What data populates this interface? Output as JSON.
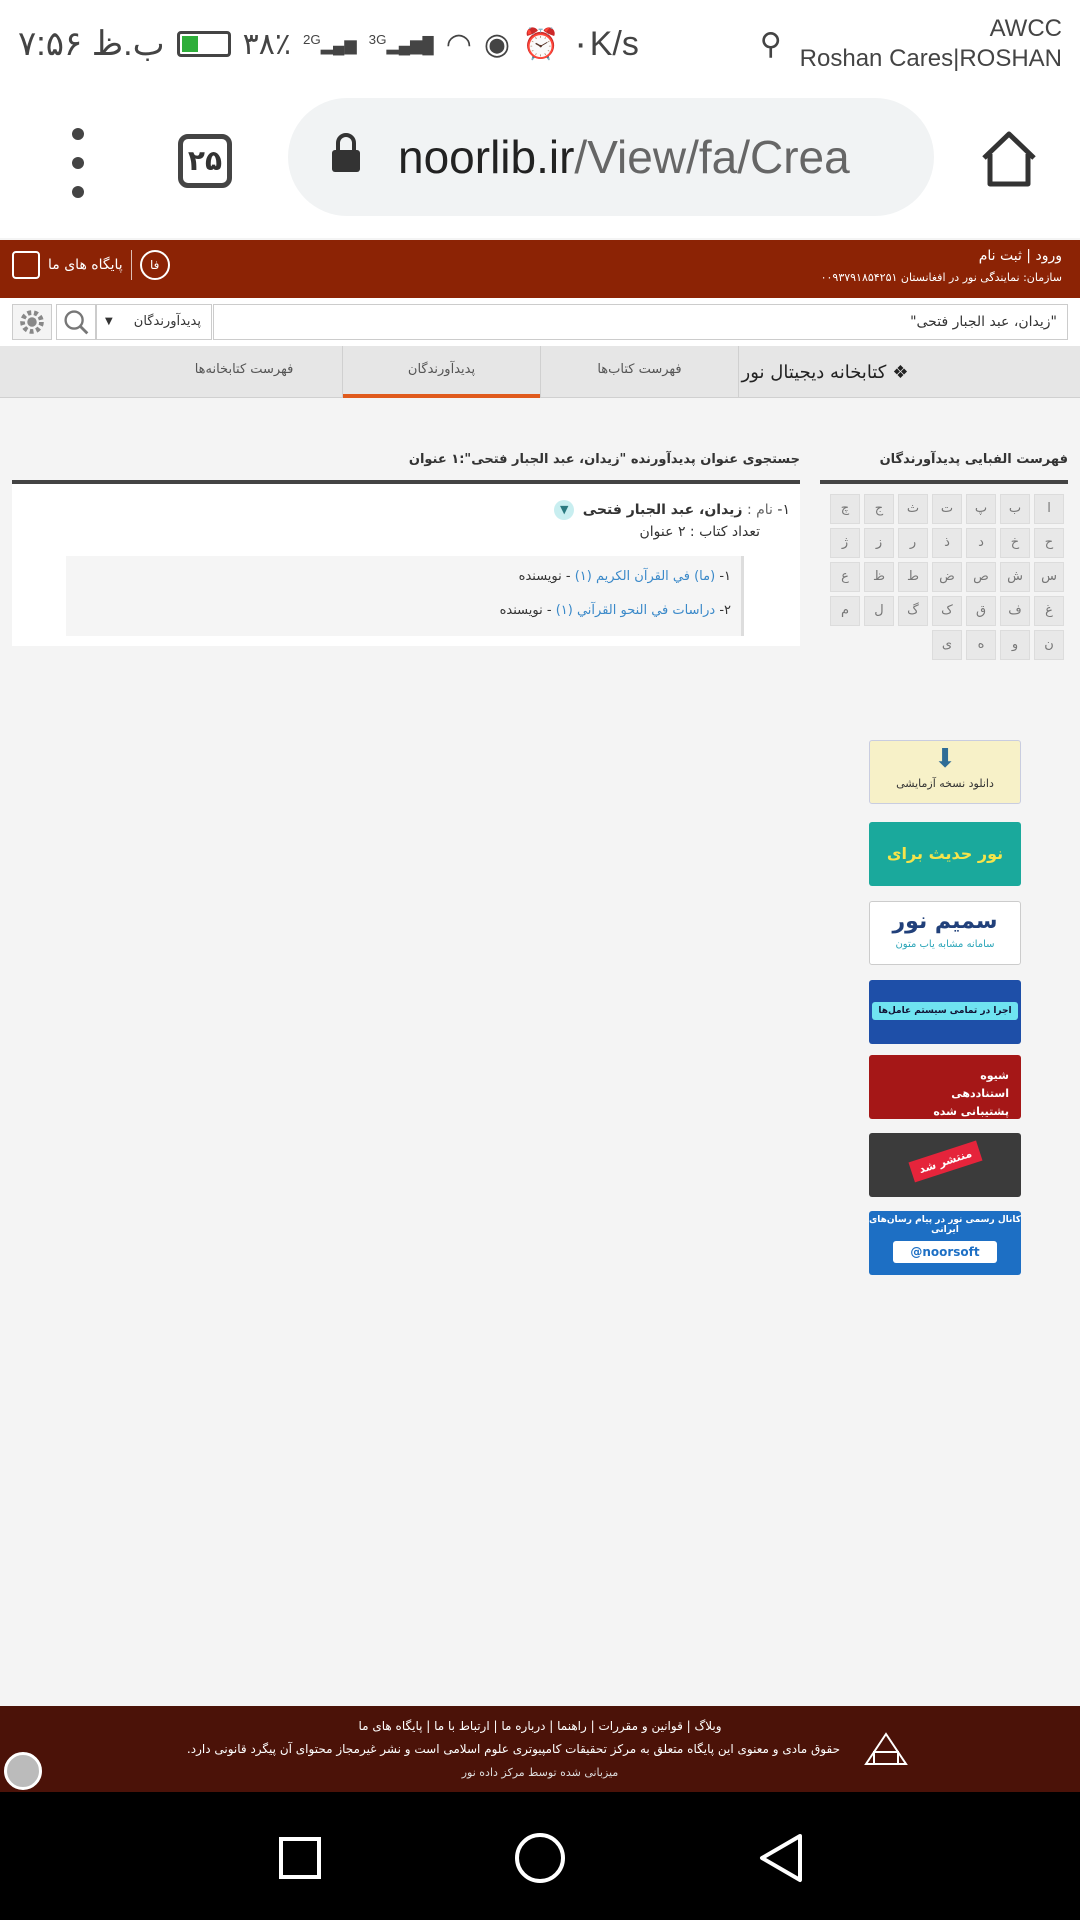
{
  "status_bar": {
    "time": "۷:۵۶ ب.ظ",
    "battery": "۳۸٪",
    "battery_fill": 0.38,
    "network": "2G",
    "network2": "3G",
    "speed": "۰K/s",
    "carrier_1": "AWCC",
    "carrier_2": "Roshan Cares|ROSHAN"
  },
  "browser": {
    "tab_count": "۲۵",
    "url_host": "noorlib.ir",
    "url_path": "/View/fa/Crea"
  },
  "site_header": {
    "login": "ورود",
    "register": "ثبت نام",
    "org": "سازمان: نمایندگی نور در افغانستان ۰۰۹۳۷۹۱۸۵۴۲۵۱",
    "bases_label": "پایگاه های ما",
    "lang": "فا"
  },
  "search": {
    "query": "\"زیدان، عبد الجبار فتحی\"",
    "scope": "پدیدآورندگان"
  },
  "nav": {
    "logo": "کتابخانه دیجیتال نور",
    "tabs": [
      "فهرست کتاب‌ها",
      "پدیدآورندگان",
      "فهرست کتابخانه‌ها"
    ]
  },
  "alpha": {
    "title": "فهرست الفبایی پدیدآورندگان",
    "letters": [
      "ا",
      "ب",
      "پ",
      "ت",
      "ث",
      "ج",
      "چ",
      "ح",
      "خ",
      "د",
      "ذ",
      "ر",
      "ز",
      "ژ",
      "س",
      "ش",
      "ص",
      "ض",
      "ط",
      "ظ",
      "ع",
      "غ",
      "ف",
      "ق",
      "ک",
      "گ",
      "ل",
      "م",
      "ن",
      "و",
      "ه",
      "ی"
    ]
  },
  "results": {
    "title": "جستجوی عنوان پدیدآورنده \"زیدان، عبد الجبار فتحی\":۱ عنوان",
    "item_index": "۱-",
    "name_label": "نام :",
    "name_bold": "زیدان",
    "name_rest": "، عبد الجبار فتحی",
    "count_line": "تعداد کتاب : ۲ عنوان",
    "works": [
      {
        "idx": "۱-",
        "title": "(ما) في القرآن الكريم (۱)",
        "role": " - نویسنده"
      },
      {
        "idx": "۲-",
        "title": "دراسات في النحو القرآني (۱)",
        "role": " - نویسنده"
      }
    ]
  },
  "ads": [
    {
      "text": "دانلود نسخه آزمایشی"
    },
    {
      "text": "نور حدیث برای"
    },
    {
      "text": "سمیم نور",
      "sub": "سامانه مشابه یاب متون"
    },
    {
      "text": "اجرا در تمامی سیستم عامل‌ها"
    },
    {
      "text": "شیوه استناددهی پشتیبانی شده در"
    },
    {
      "text": "منتشر شد"
    },
    {
      "text": "کانال رسمی نور در پیام رسان‌های ایرانی",
      "sub": "@noorsoft"
    }
  ],
  "footer": {
    "links": "وبلاگ | قوانین و مقررات | راهنما | درباره ما | ارتباط با ما | پایگاه های ما",
    "rights": "حقوق مادی و معنوی این پایگاه متعلق به  مرکز تحقیقات کامپیوتری علوم اسلامی  است و نشر غیرمجاز محتوای آن پیگرد قانونی دارد.",
    "hosted": "میزبانی شده توسط  مرکز داده نور"
  }
}
